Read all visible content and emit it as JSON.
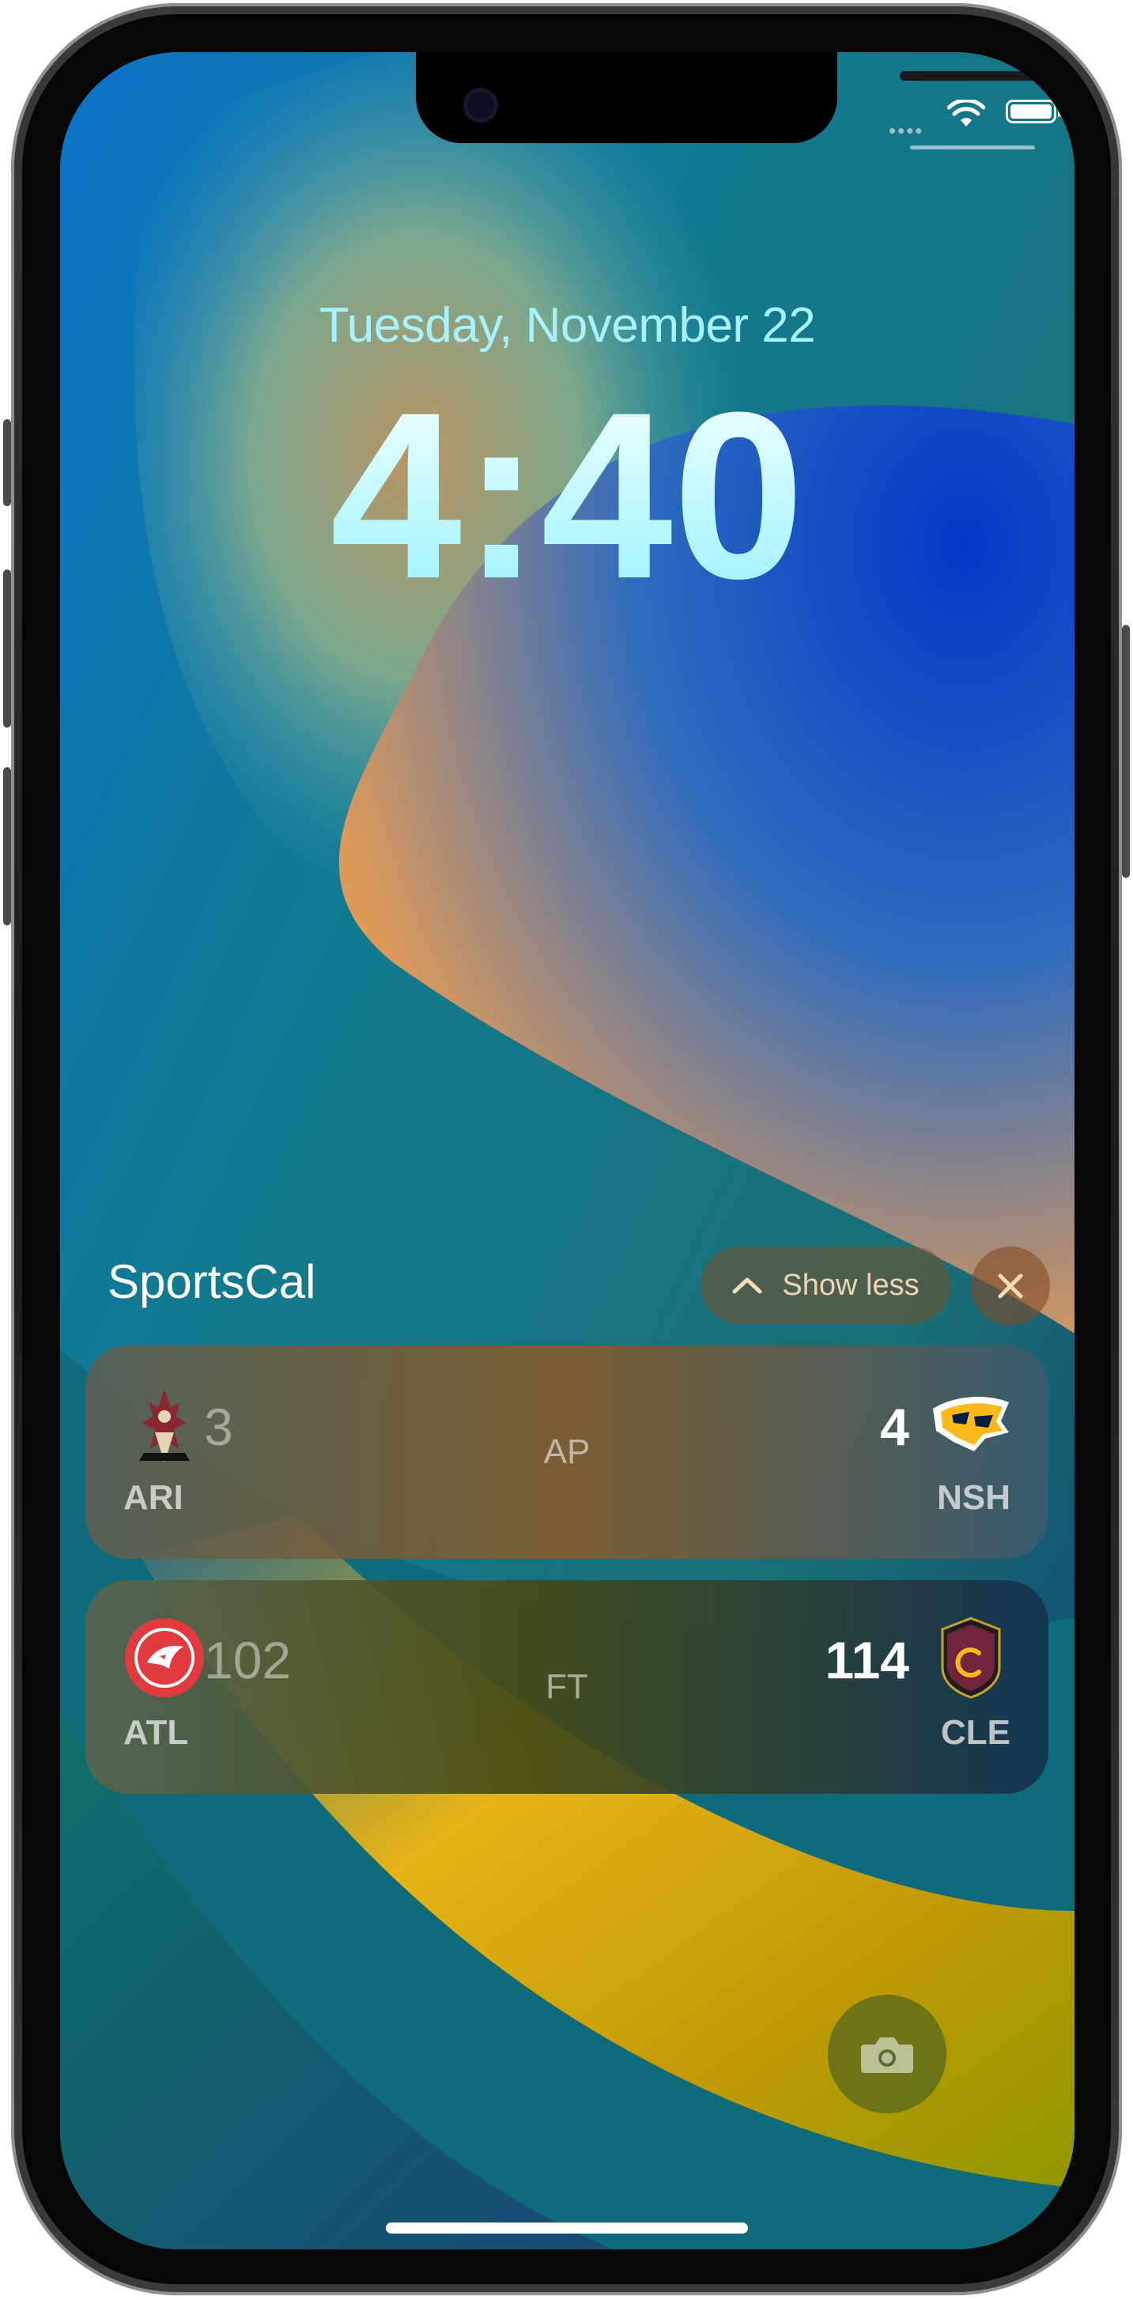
{
  "lock_screen": {
    "date": "Tuesday, November 22",
    "time": "4:40"
  },
  "notification": {
    "app_name": "SportsCal",
    "show_less_label": "Show less",
    "games": [
      {
        "away_team": "ARI",
        "away_score": "3",
        "home_team": "NSH",
        "home_score": "4",
        "status": "AP"
      },
      {
        "away_team": "ATL",
        "away_score": "102",
        "home_team": "CLE",
        "home_score": "114",
        "status": "FT"
      }
    ]
  },
  "icons": {
    "wifi": "wifi-icon",
    "battery": "battery-icon",
    "show_less": "chevron-up-icon",
    "close": "close-icon",
    "camera": "camera-icon"
  },
  "colors": {
    "date_text": "#a6f3ff",
    "time_text": "#c8f9ff",
    "winner_score": "#ffffff"
  }
}
